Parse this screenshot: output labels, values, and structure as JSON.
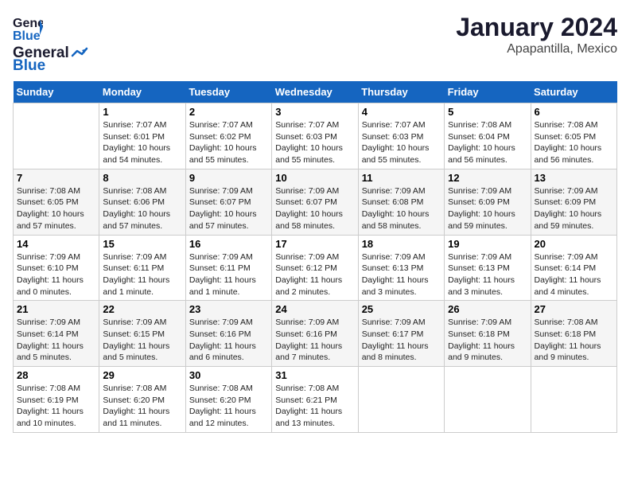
{
  "logo": {
    "line1": "General",
    "line2": "Blue"
  },
  "title": "January 2024",
  "location": "Apapantilla, Mexico",
  "days_header": [
    "Sunday",
    "Monday",
    "Tuesday",
    "Wednesday",
    "Thursday",
    "Friday",
    "Saturday"
  ],
  "weeks": [
    [
      {
        "day": "",
        "info": ""
      },
      {
        "day": "1",
        "info": "Sunrise: 7:07 AM\nSunset: 6:01 PM\nDaylight: 10 hours\nand 54 minutes."
      },
      {
        "day": "2",
        "info": "Sunrise: 7:07 AM\nSunset: 6:02 PM\nDaylight: 10 hours\nand 55 minutes."
      },
      {
        "day": "3",
        "info": "Sunrise: 7:07 AM\nSunset: 6:03 PM\nDaylight: 10 hours\nand 55 minutes."
      },
      {
        "day": "4",
        "info": "Sunrise: 7:07 AM\nSunset: 6:03 PM\nDaylight: 10 hours\nand 55 minutes."
      },
      {
        "day": "5",
        "info": "Sunrise: 7:08 AM\nSunset: 6:04 PM\nDaylight: 10 hours\nand 56 minutes."
      },
      {
        "day": "6",
        "info": "Sunrise: 7:08 AM\nSunset: 6:05 PM\nDaylight: 10 hours\nand 56 minutes."
      }
    ],
    [
      {
        "day": "7",
        "info": "Sunrise: 7:08 AM\nSunset: 6:05 PM\nDaylight: 10 hours\nand 57 minutes."
      },
      {
        "day": "8",
        "info": "Sunrise: 7:08 AM\nSunset: 6:06 PM\nDaylight: 10 hours\nand 57 minutes."
      },
      {
        "day": "9",
        "info": "Sunrise: 7:09 AM\nSunset: 6:07 PM\nDaylight: 10 hours\nand 57 minutes."
      },
      {
        "day": "10",
        "info": "Sunrise: 7:09 AM\nSunset: 6:07 PM\nDaylight: 10 hours\nand 58 minutes."
      },
      {
        "day": "11",
        "info": "Sunrise: 7:09 AM\nSunset: 6:08 PM\nDaylight: 10 hours\nand 58 minutes."
      },
      {
        "day": "12",
        "info": "Sunrise: 7:09 AM\nSunset: 6:09 PM\nDaylight: 10 hours\nand 59 minutes."
      },
      {
        "day": "13",
        "info": "Sunrise: 7:09 AM\nSunset: 6:09 PM\nDaylight: 10 hours\nand 59 minutes."
      }
    ],
    [
      {
        "day": "14",
        "info": "Sunrise: 7:09 AM\nSunset: 6:10 PM\nDaylight: 11 hours\nand 0 minutes."
      },
      {
        "day": "15",
        "info": "Sunrise: 7:09 AM\nSunset: 6:11 PM\nDaylight: 11 hours\nand 1 minute."
      },
      {
        "day": "16",
        "info": "Sunrise: 7:09 AM\nSunset: 6:11 PM\nDaylight: 11 hours\nand 1 minute."
      },
      {
        "day": "17",
        "info": "Sunrise: 7:09 AM\nSunset: 6:12 PM\nDaylight: 11 hours\nand 2 minutes."
      },
      {
        "day": "18",
        "info": "Sunrise: 7:09 AM\nSunset: 6:13 PM\nDaylight: 11 hours\nand 3 minutes."
      },
      {
        "day": "19",
        "info": "Sunrise: 7:09 AM\nSunset: 6:13 PM\nDaylight: 11 hours\nand 3 minutes."
      },
      {
        "day": "20",
        "info": "Sunrise: 7:09 AM\nSunset: 6:14 PM\nDaylight: 11 hours\nand 4 minutes."
      }
    ],
    [
      {
        "day": "21",
        "info": "Sunrise: 7:09 AM\nSunset: 6:14 PM\nDaylight: 11 hours\nand 5 minutes."
      },
      {
        "day": "22",
        "info": "Sunrise: 7:09 AM\nSunset: 6:15 PM\nDaylight: 11 hours\nand 5 minutes."
      },
      {
        "day": "23",
        "info": "Sunrise: 7:09 AM\nSunset: 6:16 PM\nDaylight: 11 hours\nand 6 minutes."
      },
      {
        "day": "24",
        "info": "Sunrise: 7:09 AM\nSunset: 6:16 PM\nDaylight: 11 hours\nand 7 minutes."
      },
      {
        "day": "25",
        "info": "Sunrise: 7:09 AM\nSunset: 6:17 PM\nDaylight: 11 hours\nand 8 minutes."
      },
      {
        "day": "26",
        "info": "Sunrise: 7:09 AM\nSunset: 6:18 PM\nDaylight: 11 hours\nand 9 minutes."
      },
      {
        "day": "27",
        "info": "Sunrise: 7:08 AM\nSunset: 6:18 PM\nDaylight: 11 hours\nand 9 minutes."
      }
    ],
    [
      {
        "day": "28",
        "info": "Sunrise: 7:08 AM\nSunset: 6:19 PM\nDaylight: 11 hours\nand 10 minutes."
      },
      {
        "day": "29",
        "info": "Sunrise: 7:08 AM\nSunset: 6:20 PM\nDaylight: 11 hours\nand 11 minutes."
      },
      {
        "day": "30",
        "info": "Sunrise: 7:08 AM\nSunset: 6:20 PM\nDaylight: 11 hours\nand 12 minutes."
      },
      {
        "day": "31",
        "info": "Sunrise: 7:08 AM\nSunset: 6:21 PM\nDaylight: 11 hours\nand 13 minutes."
      },
      {
        "day": "",
        "info": ""
      },
      {
        "day": "",
        "info": ""
      },
      {
        "day": "",
        "info": ""
      }
    ]
  ]
}
